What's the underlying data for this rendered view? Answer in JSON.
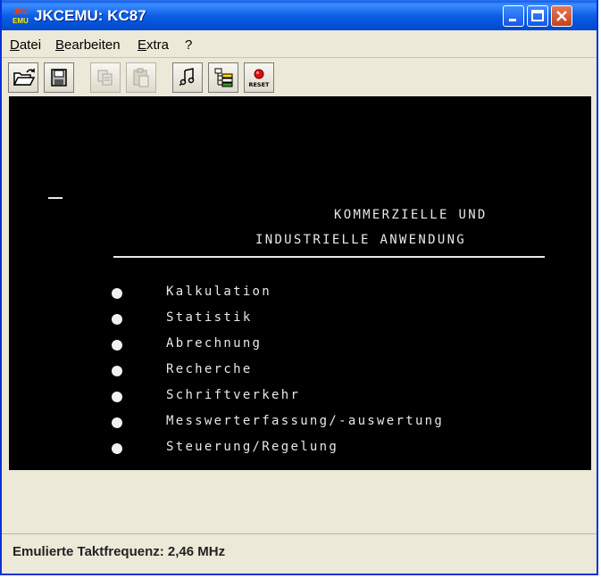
{
  "window": {
    "title": "JKCEMU: KC87",
    "icon": {
      "name": "jkcemu-icon",
      "top_text": "JKC",
      "bottom_text": "EMU"
    }
  },
  "titlebar_buttons": [
    "minimize-icon",
    "maximize-icon",
    "close-icon"
  ],
  "menu": [
    {
      "label": "Datei",
      "mnemonic": "D",
      "rest": "atei"
    },
    {
      "label": "Bearbeiten",
      "mnemonic": "B",
      "rest": "earbeiten"
    },
    {
      "label": "Extra",
      "mnemonic": "E",
      "rest": "xtra"
    },
    {
      "label": "?",
      "mnemonic": "",
      "rest": "?"
    }
  ],
  "toolbar": [
    {
      "icon": "open-folder-icon",
      "enabled": true
    },
    {
      "icon": "save-disk-icon",
      "enabled": true
    },
    {
      "icon": "copy-icon",
      "enabled": false
    },
    {
      "icon": "paste-icon",
      "enabled": false
    },
    {
      "icon": "audio-icon",
      "enabled": true
    },
    {
      "icon": "tree-icon",
      "enabled": true
    },
    {
      "icon": "reset-icon",
      "enabled": true,
      "label": "RESET"
    }
  ],
  "screen": {
    "cursor": "_",
    "heading_line1": "KOMMERZIELLE UND",
    "heading_line2": "INDUSTRIELLE ANWENDUNG",
    "items": [
      "Kalkulation",
      "Statistik",
      "Abrechnung",
      "Recherche",
      "Schriftverkehr",
      "Messwerterfassung/-auswertung",
      "Steuerung/Regelung"
    ]
  },
  "status": {
    "text": "Emulierte Taktfrequenz: 2,46 MHz"
  },
  "colors": {
    "titlebar": "#0a5ee6",
    "screen_bg": "#000000",
    "screen_fg": "#e8e8e8",
    "window_bg": "#ece9d8"
  }
}
